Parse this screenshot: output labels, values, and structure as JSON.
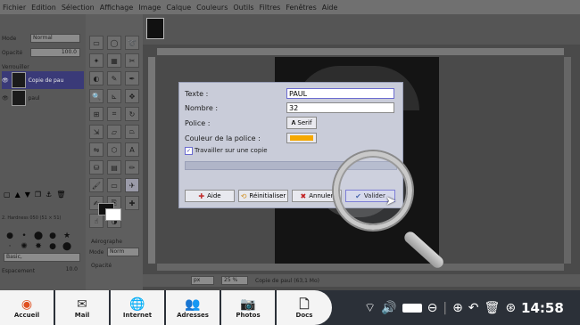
{
  "menubar": [
    "Fichier",
    "Edition",
    "Sélection",
    "Affichage",
    "Image",
    "Calque",
    "Couleurs",
    "Outils",
    "Filtres",
    "Fenêtres",
    "Aide"
  ],
  "left_panel": {
    "mode_label": "Mode",
    "mode_value": "Normal",
    "opacity_label": "Opacité",
    "opacity_value": "100.0",
    "lock_label": "Verrouiller",
    "layers": [
      {
        "name": "Copie de pau",
        "selected": true
      },
      {
        "name": "paul",
        "selected": false
      }
    ],
    "brush_info": "2. Hardness 050 (51 × 51)",
    "brush_select": "Basic,",
    "spacing_label": "Espacement",
    "spacing_value": "10.0"
  },
  "tool_options": {
    "title": "Aérographe",
    "mode_label": "Mode",
    "mode_value": "Norm",
    "opacity_label": "Opacité"
  },
  "status": {
    "unit": "px",
    "zoom": "25 %",
    "label": "Copie de paul (63,1 Mo)"
  },
  "dialog": {
    "text_label": "Texte :",
    "text_value": "PAUL",
    "number_label": "Nombre :",
    "number_value": "32",
    "font_label": "Police :",
    "font_value": "Serif",
    "color_label": "Couleur de la police :",
    "font_color": "#f5a800",
    "copy_label": "Travailler sur une copie",
    "copy_checked": true,
    "buttons": {
      "help": "Aide",
      "reset": "Réinitialiser",
      "cancel": "Annuler",
      "ok": "Valider"
    }
  },
  "dock": [
    {
      "label": "Accueil",
      "icon": "home-logo-icon"
    },
    {
      "label": "Mail",
      "icon": "mail-icon"
    },
    {
      "label": "Internet",
      "icon": "globe-icon"
    },
    {
      "label": "Adresses",
      "icon": "contacts-icon"
    },
    {
      "label": "Photos",
      "icon": "camera-icon"
    },
    {
      "label": "Docs",
      "icon": "documents-icon"
    }
  ],
  "tray": {
    "time": "14:58"
  }
}
